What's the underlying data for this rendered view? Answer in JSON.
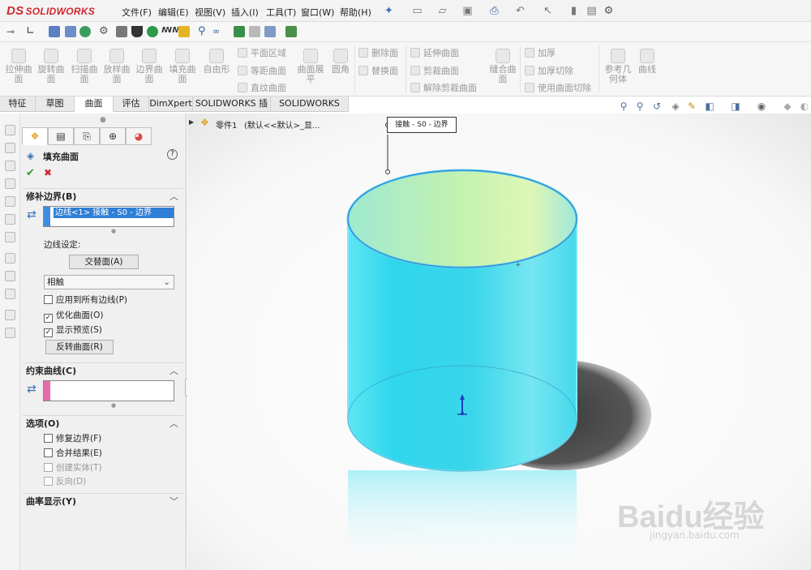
{
  "app": {
    "name": "SOLIDWORKS",
    "logo_prefix": "DS"
  },
  "menu": [
    "文件(F)",
    "编辑(E)",
    "视图(V)",
    "插入(I)",
    "工具(T)",
    "窗口(W)",
    "帮助(H)"
  ],
  "ribbon": {
    "big_buttons": [
      "拉伸曲\n面",
      "旋转曲\n面",
      "扫描曲\n面",
      "放样曲\n面",
      "边界曲\n面",
      "填充曲\n面",
      "自由形",
      "曲面展\n平",
      "圆角",
      "缝合曲\n面",
      "参考几\n何体",
      "曲线"
    ],
    "small_buttons": [
      "平面区域",
      "等距曲面",
      "直纹曲面",
      "删除面",
      "替换面",
      "延伸曲面",
      "剪裁曲面",
      "解除剪裁曲面",
      "加厚",
      "加厚切除",
      "使用曲面切除"
    ]
  },
  "tabs": [
    "特征",
    "草图",
    "曲面",
    "评估",
    "DimXpert",
    "SOLIDWORKS 插件",
    "SOLIDWORKS MBD"
  ],
  "active_tab": "曲面",
  "property_manager": {
    "title": "填充曲面",
    "help": "?",
    "ok": "✔",
    "cancel": "✖",
    "patch_boundary": {
      "header": "修补边界(B)",
      "selection": "边线<1> 接触 - S0 - 边界",
      "edge_settings_label": "边线设定:",
      "alternate_face_button": "交替面(A)",
      "condition_value": "相触",
      "apply_all_edges": {
        "label": "应用到所有边线(P)",
        "checked": false
      },
      "optimize_surface": {
        "label": "优化曲面(O)",
        "checked": true
      },
      "show_preview": {
        "label": "显示预览(S)",
        "checked": true
      },
      "reverse_surface_button": "反转曲面(R)"
    },
    "constraint_curves": {
      "header": "约束曲线(C)"
    },
    "options": {
      "header": "选项(O)",
      "fix_boundary": {
        "label": "修复边界(F)",
        "checked": false
      },
      "merge_result": {
        "label": "合并结果(E)",
        "checked": false
      },
      "try_form_solid": {
        "label": "创建实体(T)",
        "checked": false,
        "disabled": true
      },
      "reverse": {
        "label": "反向(D)",
        "checked": false,
        "disabled": true
      }
    },
    "curvature_display": {
      "header": "曲率显示(Y)"
    }
  },
  "feature_tree": {
    "part_label": "零件1",
    "config_label": "(默认<<默认>_显..."
  },
  "callout": "接触 - S0 - 边界",
  "watermark": {
    "main": "Baidu经验",
    "sub": "jingyan.baidu.com"
  },
  "colors": {
    "accent": "#d0282e",
    "selection": "#3c8ee0",
    "cyl_body": "#38d9ec",
    "cyl_top": "#cdf0a8"
  }
}
